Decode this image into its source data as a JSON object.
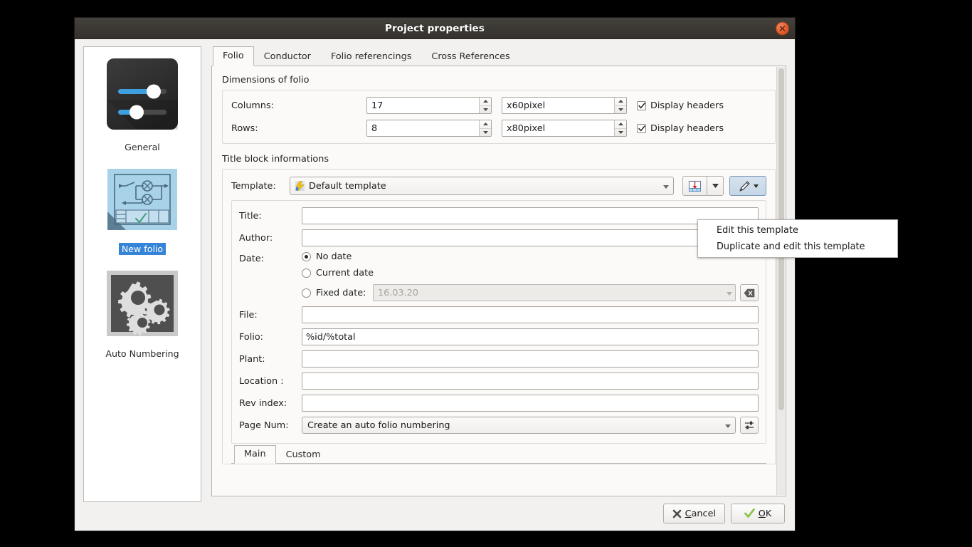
{
  "window": {
    "title": "Project properties",
    "close_icon": "close-icon"
  },
  "sidebar": {
    "items": [
      {
        "label": "General",
        "icon": "sliders-icon",
        "selected": false
      },
      {
        "label": "New folio",
        "icon": "schematic-folio-icon",
        "selected": true
      },
      {
        "label": "Auto Numbering",
        "icon": "gears-icon",
        "selected": false
      }
    ]
  },
  "tabs": [
    {
      "label": "Folio",
      "active": true
    },
    {
      "label": "Conductor",
      "active": false
    },
    {
      "label": "Folio referencings",
      "active": false
    },
    {
      "label": "Cross References",
      "active": false
    }
  ],
  "dimensions": {
    "group_title": "Dimensions of folio",
    "columns": {
      "label": "Columns:",
      "count": "17",
      "size": "x60pixel",
      "display_headers_label": "Display headers",
      "display_headers_checked": true
    },
    "rows": {
      "label": "Rows:",
      "count": "8",
      "size": "x80pixel",
      "display_headers_label": "Display headers",
      "display_headers_checked": true
    }
  },
  "title_block": {
    "group_title": "Title block informations",
    "template_label": "Template:",
    "template_value": "Default template",
    "template_icon": "lightning-bolt-icon",
    "import_button_icon": "import-titleblock-icon",
    "import_dropdown_icon": "chevron-down-icon",
    "edit_button_icon": "pencil-icon",
    "edit_dropdown_icon": "chevron-down-icon",
    "fields": {
      "title": {
        "label": "Title:",
        "value": ""
      },
      "author": {
        "label": "Author:",
        "value": ""
      },
      "date": {
        "label": "Date:",
        "options": [
          {
            "label": "No date",
            "selected": true
          },
          {
            "label": "Current date",
            "selected": false
          },
          {
            "label": "Fixed date:",
            "selected": false
          }
        ],
        "fixed_value": "16.03.20",
        "clear_icon": "erase-icon"
      },
      "file": {
        "label": "File:",
        "value": ""
      },
      "folio": {
        "label": "Folio:",
        "value": "%id/%total"
      },
      "plant": {
        "label": "Plant:",
        "value": ""
      },
      "location": {
        "label": "Location :",
        "value": ""
      },
      "rev_index": {
        "label": "Rev index:",
        "value": ""
      },
      "page_num": {
        "label": "Page Num:",
        "value": "Create an auto folio numbering",
        "config_icon": "sliders-small-icon"
      }
    },
    "subtabs": [
      {
        "label": "Main",
        "active": true
      },
      {
        "label": "Custom",
        "active": false
      }
    ]
  },
  "popup_menu": {
    "items": [
      {
        "label": "Edit this template"
      },
      {
        "label": "Duplicate and edit this template"
      }
    ]
  },
  "footer": {
    "cancel": {
      "prefix": "",
      "mnemonic": "C",
      "rest": "ancel",
      "icon": "cross-icon"
    },
    "ok": {
      "mnemonic": "O",
      "rest": "K",
      "icon": "check-icon"
    }
  },
  "colors": {
    "accent": "#3584d8",
    "titlebar": "#3c3935",
    "close": "#e05d30",
    "ok_check": "#8bc34a"
  }
}
